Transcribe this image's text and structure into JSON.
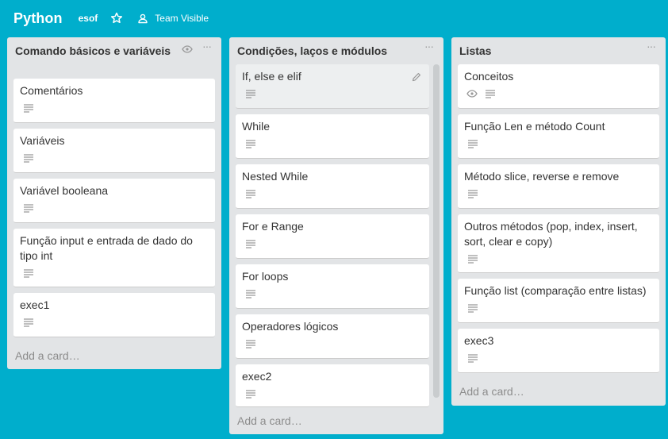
{
  "header": {
    "board_title": "Python",
    "org": "esof",
    "team_visibility": "Team Visible",
    "icons": {
      "star": "star-icon",
      "team": "team-icon"
    }
  },
  "colors": {
    "background": "#00aecc",
    "list": "#e2e4e6",
    "card": "#ffffff"
  },
  "lists": [
    {
      "title": "Comando básicos e variáveis",
      "add_card": "Add a card…",
      "cards": [
        {
          "title": "Comentários"
        },
        {
          "title": "Variáveis"
        },
        {
          "title": "Variável booleana"
        },
        {
          "title": "Função input e entrada de dado do tipo int"
        },
        {
          "title": "exec1"
        }
      ]
    },
    {
      "title": "Condições, laços e módulos",
      "add_card": "Add a card…",
      "cards": [
        {
          "title": "If, else e elif"
        },
        {
          "title": "While"
        },
        {
          "title": "Nested While"
        },
        {
          "title": "For e Range"
        },
        {
          "title": "For loops"
        },
        {
          "title": "Operadores lógicos"
        },
        {
          "title": "exec2"
        }
      ]
    },
    {
      "title": "Listas",
      "add_card": "Add a card…",
      "cards": [
        {
          "title": "Conceitos"
        },
        {
          "title": "Função Len e método Count"
        },
        {
          "title": "Método slice, reverse e remove"
        },
        {
          "title": "Outros métodos (pop, index, insert, sort, clear e copy)"
        },
        {
          "title": "Função list (comparação entre listas)"
        },
        {
          "title": "exec3"
        }
      ]
    }
  ]
}
